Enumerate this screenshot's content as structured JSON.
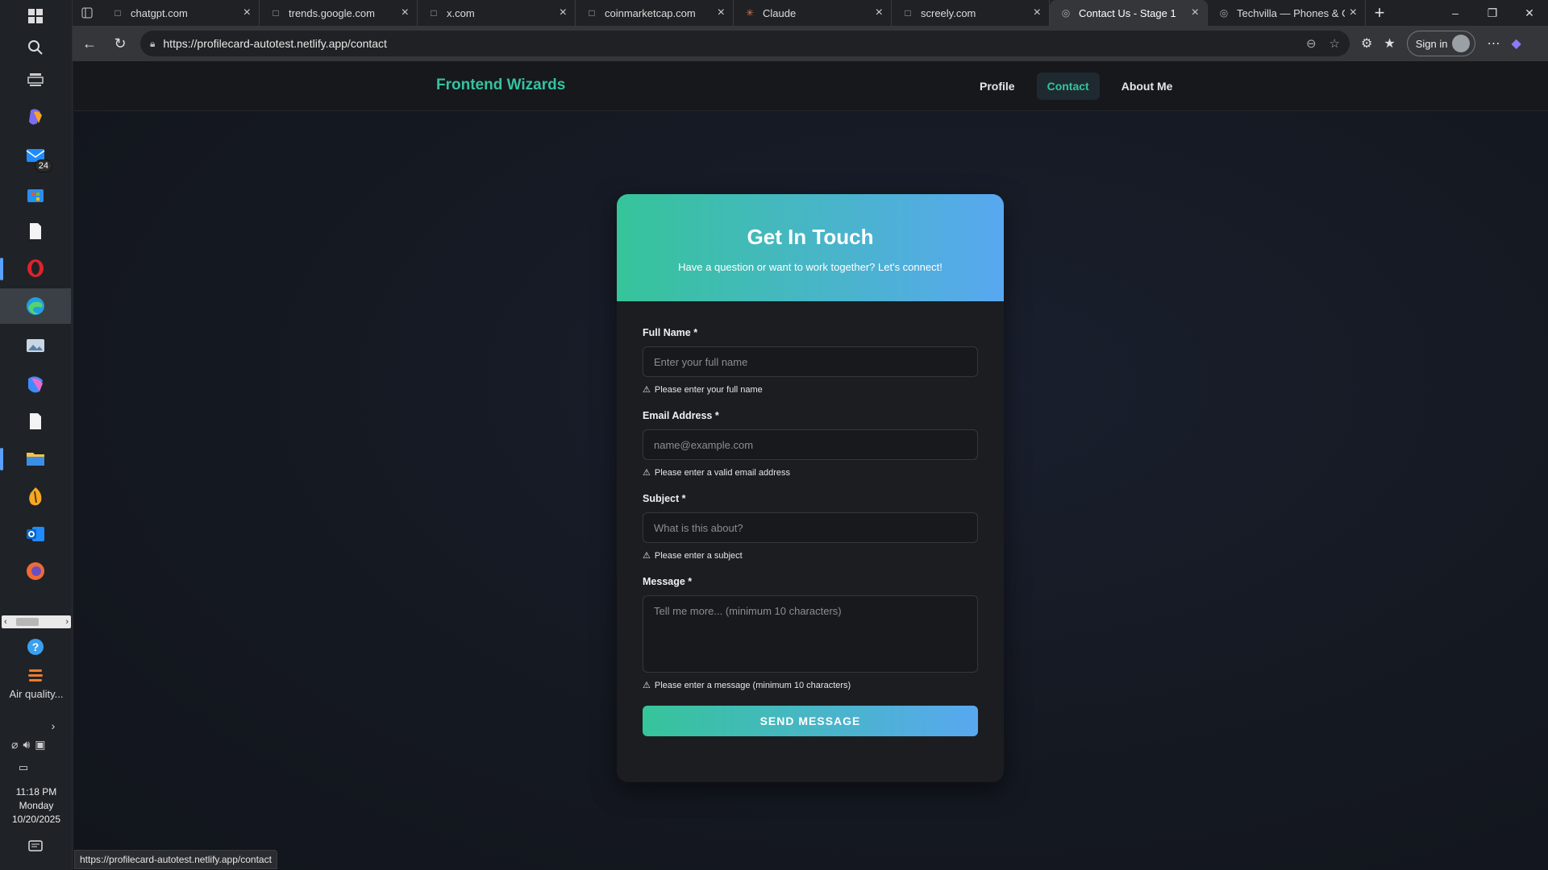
{
  "taskbar": {
    "mail_badge": "24",
    "weather_text": "Air quality...",
    "clock": {
      "time": "11:18 PM",
      "day": "Monday",
      "date": "10/20/2025"
    }
  },
  "browser": {
    "tabs": [
      {
        "title": "chatgpt.com",
        "favicon": "page-icon"
      },
      {
        "title": "trends.google.com",
        "favicon": "page-icon"
      },
      {
        "title": "x.com",
        "favicon": "page-icon"
      },
      {
        "title": "coinmarketcap.com",
        "favicon": "page-icon"
      },
      {
        "title": "Claude",
        "favicon": "claude-icon"
      },
      {
        "title": "screely.com",
        "favicon": "page-icon"
      },
      {
        "title": "Contact Us - Stage 1",
        "favicon": "globe-icon",
        "active": true
      },
      {
        "title": "Techvilla — Phones & Ga",
        "favicon": "globe-icon"
      }
    ],
    "url": "https://profilecard-autotest.netlify.app/contact",
    "sign_in_label": "Sign in",
    "status_url": "https://profilecard-autotest.netlify.app/contact"
  },
  "site": {
    "brand": "Frontend Wizards",
    "nav": [
      "Profile",
      "Contact",
      "About Me"
    ],
    "active_nav": "Contact",
    "accent": "#36c2a0"
  },
  "contact": {
    "title": "Get In Touch",
    "subtitle": "Have a question or want to work together? Let's connect!",
    "fields": {
      "name": {
        "label": "Full Name *",
        "placeholder": "Enter your full name",
        "error": "Please enter your full name"
      },
      "email": {
        "label": "Email Address *",
        "placeholder": "name@example.com",
        "error": "Please enter a valid email address"
      },
      "subject": {
        "label": "Subject *",
        "placeholder": "What is this about?",
        "error": "Please enter a subject"
      },
      "message": {
        "label": "Message *",
        "placeholder": "Tell me more... (minimum 10 characters)",
        "error": "Please enter a message (minimum 10 characters)"
      }
    },
    "submit_label": "SEND MESSAGE",
    "gradient": [
      "#36c49a",
      "#58a8f0"
    ]
  }
}
